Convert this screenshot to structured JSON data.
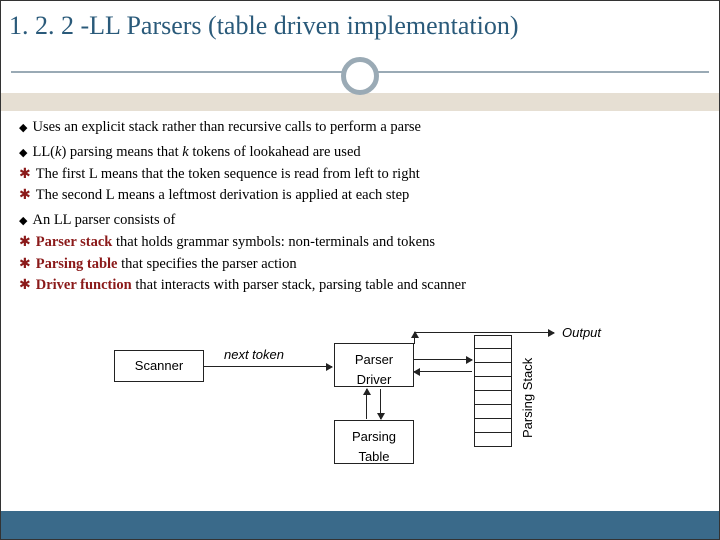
{
  "title": "1. 2. 2 -LL Parsers (table driven implementation)",
  "bullets": {
    "b1": "Uses an explicit stack rather than recursive calls to perform a parse",
    "b2_pre": "LL(",
    "b2_k1": "k",
    "b2_mid": ") parsing means that ",
    "b2_k2": "k",
    "b2_post": " tokens of lookahead are used",
    "b2_sub1": "The first L means that the token sequence is read from left to right",
    "b2_sub2": "The second L means a leftmost derivation is applied at each step",
    "b3": "An LL parser consists of",
    "b3_sub1_head": "Parser stack",
    "b3_sub1_rest": " that holds grammar symbols: non-terminals and tokens",
    "b3_sub2_head": "Parsing table",
    "b3_sub2_rest": " that specifies the parser action",
    "b3_sub3_head": "Driver function",
    "b3_sub3_rest": " that interacts with parser stack, parsing table and scanner"
  },
  "diagram": {
    "scanner": "Scanner",
    "driver_l1": "Parser",
    "driver_l2": "Driver",
    "table_l1": "Parsing",
    "table_l2": "Table",
    "next_token": "next token",
    "output": "Output",
    "stack_label": "Parsing Stack"
  }
}
